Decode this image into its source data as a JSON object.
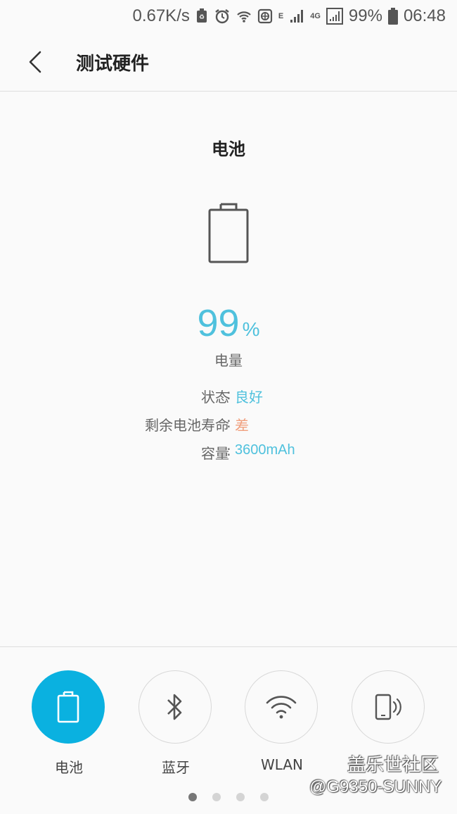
{
  "status_bar": {
    "net_speed": "0.67K/s",
    "network_type_e": "E",
    "network_type_4g": "4G",
    "battery_percent": "99%",
    "time": "06:48",
    "icons": [
      "recycle-icon",
      "alarm-icon",
      "wifi-icon",
      "data-saver-icon",
      "signal-icon",
      "signal-icon",
      "battery-icon"
    ]
  },
  "app_bar": {
    "title": "测试硬件"
  },
  "battery": {
    "section_title": "电池",
    "level_value": "99",
    "level_unit": "%",
    "level_label": "电量",
    "rows": [
      {
        "key": "状态",
        "sep": ":",
        "value": "良好"
      },
      {
        "key": "剩余电池寿命",
        "sep": ":",
        "value": "差"
      },
      {
        "key": "容量",
        "sep": ":",
        "value": "3600mAh"
      }
    ]
  },
  "tabs": [
    {
      "label": "电池",
      "icon": "battery-icon",
      "active": true
    },
    {
      "label": "蓝牙",
      "icon": "bluetooth-icon",
      "active": false
    },
    {
      "label": "WLAN",
      "icon": "wifi-icon",
      "active": false
    },
    {
      "label": "",
      "icon": "vibration-icon",
      "active": false
    }
  ],
  "page_indicator": {
    "current": 1,
    "total": 4
  },
  "watermark": {
    "line1": "盖乐世社区",
    "line2": "@G9350-SUNNY"
  },
  "colors": {
    "accent": "#0ab1e0",
    "value_good": "#4fc1dd",
    "value_bad": "#f0a07e"
  }
}
